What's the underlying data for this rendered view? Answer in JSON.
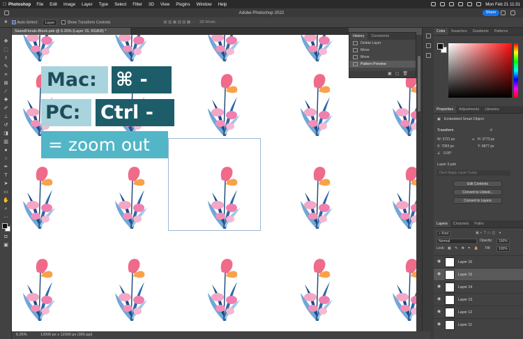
{
  "menubar": {
    "apple": "",
    "app": "Photoshop",
    "items": [
      "File",
      "Edit",
      "Image",
      "Layer",
      "Type",
      "Select",
      "Filter",
      "3D",
      "View",
      "Plugins",
      "Window",
      "Help"
    ],
    "clock": "Mon Feb 21  11:31"
  },
  "titlebar": {
    "title": "Adobe Photoshop 2022",
    "share": "Share"
  },
  "options": {
    "auto_select": "Auto-Select:",
    "auto_select_value": "Layer",
    "transform": "Show Transform Controls",
    "mode3d": "3D Mode:"
  },
  "document": {
    "tab": "SweetFlorals-Block.psb @ 6.25% (Layer 15, RGB/8) *"
  },
  "overlay": {
    "mac": "Mac:",
    "cmd": "⌘ -",
    "pc": "PC:",
    "ctrl": "Ctrl -",
    "zoom": "= zoom out"
  },
  "status": {
    "zoom": "6.25%",
    "info": "12000 px x 12000 px (300 ppi)"
  },
  "history": {
    "tabs": [
      "History",
      "Comments"
    ],
    "items": [
      {
        "label": "Delete Layer",
        "active": false
      },
      {
        "label": "Move",
        "active": false
      },
      {
        "label": "Move",
        "active": false
      },
      {
        "label": "Pattern Preview",
        "active": true
      }
    ]
  },
  "color_panel": {
    "tabs": [
      "Color",
      "Swatches",
      "Gradients",
      "Patterns"
    ]
  },
  "properties": {
    "tabs": [
      "Properties",
      "Adjustments",
      "Libraries"
    ],
    "kind": "Embedded Smart Object",
    "transform_label": "Transform",
    "w": "W:  3721 px",
    "h": "H:  3773 px",
    "x": "X:  7093 px",
    "y": "Y:  6877 px",
    "angle": "0.00°",
    "source": "Layer 3.psb",
    "comp": "Don't Apply Layer Comp",
    "edit_contents": "Edit Contents",
    "convert_linked": "Convert to Linked...",
    "convert_layers": "Convert to Layers"
  },
  "layers_panel": {
    "tabs": [
      "Layers",
      "Channels",
      "Paths"
    ],
    "filter": "Kind",
    "blend": "Normal",
    "opacity_label": "Opacity:",
    "opacity": "100%",
    "lock_label": "Lock:",
    "fill_label": "Fill:",
    "fill": "100%",
    "layers": [
      {
        "name": "Layer 16",
        "active": false
      },
      {
        "name": "Layer 15",
        "active": true
      },
      {
        "name": "Layer 14",
        "active": false
      },
      {
        "name": "Layer 13",
        "active": false
      },
      {
        "name": "Layer 12",
        "active": false
      },
      {
        "name": "Layer 11",
        "active": false
      }
    ]
  },
  "colors": {
    "accent": "#1473e6",
    "overlay_light": "#a9d4dd",
    "overlay_dark": "#1d5d69",
    "overlay_teal": "#52b6c6"
  }
}
